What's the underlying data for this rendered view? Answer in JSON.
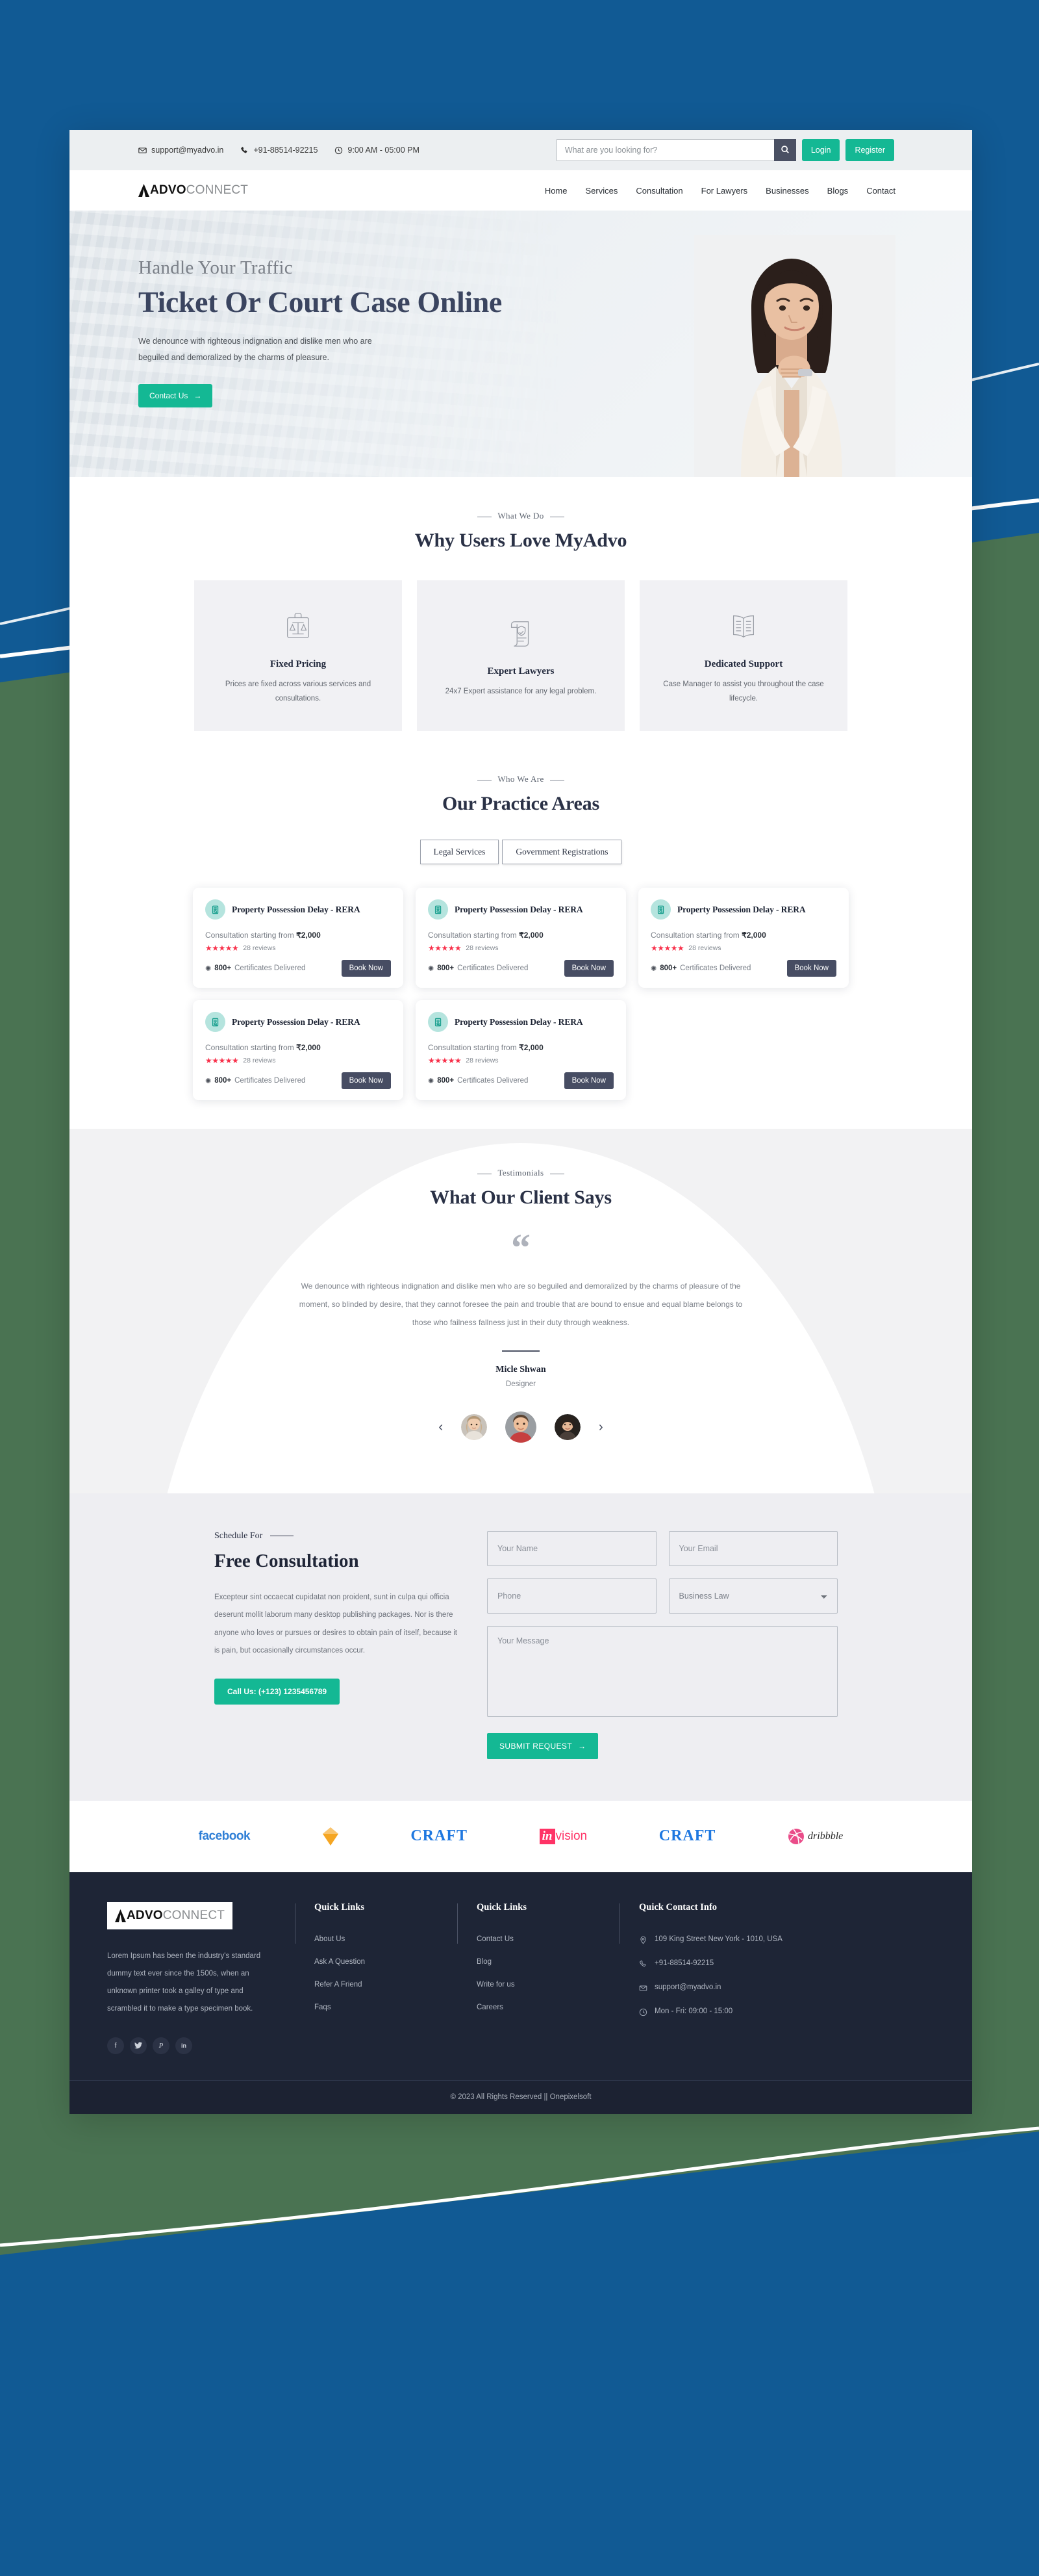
{
  "topbar": {
    "email": "support@myadvo.in",
    "phone": "+91-88514-92215",
    "hours": "9:00 AM - 05:00 PM",
    "search_placeholder": "What are you looking for?",
    "login_label": "Login",
    "register_label": "Register"
  },
  "nav": {
    "logo_bold": "ADVO",
    "logo_light": "CONNECT",
    "links": [
      {
        "label": "Home"
      },
      {
        "label": "Services"
      },
      {
        "label": "Consultation"
      },
      {
        "label": "For Lawyers"
      },
      {
        "label": "Businesses"
      },
      {
        "label": "Blogs"
      },
      {
        "label": "Contact"
      }
    ]
  },
  "hero": {
    "kicker": "Handle Your Traffic",
    "title": "Ticket Or Court Case Online",
    "subtitle": "We denounce with righteous indignation and dislike men who are beguiled and demoralized by the charms of pleasure.",
    "cta_label": "Contact Us"
  },
  "why": {
    "eyebrow": "What We Do",
    "title": "Why Users Love MyAdvo",
    "cards": [
      {
        "icon": "briefcase-scales-icon",
        "name": "Fixed Pricing",
        "desc": "Prices are fixed across various services and consultations."
      },
      {
        "icon": "scroll-shield-icon",
        "name": "Expert Lawyers",
        "desc": "24x7 Expert assistance for any legal problem."
      },
      {
        "icon": "open-book-icon",
        "name": "Dedicated Support",
        "desc": "Case Manager to assist you throughout the case lifecycle."
      }
    ]
  },
  "practice": {
    "eyebrow": "Who We Are",
    "title": "Our Practice Areas",
    "tabs": [
      {
        "label": "Legal Services",
        "active": true
      },
      {
        "label": "Government Registrations",
        "active": false
      }
    ],
    "cards": [
      {
        "title": "Property Possession Delay - RERA",
        "price_label": "Consultation starting from",
        "price": "₹2,000",
        "stars": "★★★★★",
        "reviews": "28 reviews",
        "certs_count": "800+",
        "certs_label": "Certificates Delivered",
        "book_label": "Book Now"
      },
      {
        "title": "Property Possession Delay - RERA",
        "price_label": "Consultation starting from",
        "price": "₹2,000",
        "stars": "★★★★★",
        "reviews": "28 reviews",
        "certs_count": "800+",
        "certs_label": "Certificates Delivered",
        "book_label": "Book Now"
      },
      {
        "title": "Property Possession Delay - RERA",
        "price_label": "Consultation starting from",
        "price": "₹2,000",
        "stars": "★★★★★",
        "reviews": "28 reviews",
        "certs_count": "800+",
        "certs_label": "Certificates Delivered",
        "book_label": "Book Now"
      },
      {
        "title": "Property Possession Delay - RERA",
        "price_label": "Consultation starting from",
        "price": "₹2,000",
        "stars": "★★★★★",
        "reviews": "28 reviews",
        "certs_count": "800+",
        "certs_label": "Certificates Delivered",
        "book_label": "Book Now"
      },
      {
        "title": "Property Possession Delay - RERA",
        "price_label": "Consultation starting from",
        "price": "₹2,000",
        "stars": "★★★★★",
        "reviews": "28 reviews",
        "certs_count": "800+",
        "certs_label": "Certificates Delivered",
        "book_label": "Book Now"
      }
    ]
  },
  "testimonials": {
    "eyebrow": "Testimonials",
    "title": "What Our Client Says",
    "quote_glyph": "“",
    "quote": "We denounce with righteous indignation and dislike men who are so beguiled and demoralized by the charms of pleasure of the moment, so blinded by desire, that they cannot foresee the pain and trouble that are bound to ensue and equal blame belongs to those who failness fallness just in their duty through weakness.",
    "author": "Micle Shwan",
    "role": "Designer",
    "prev_label": "‹",
    "next_label": "›"
  },
  "consultation": {
    "kicker": "Schedule For",
    "title": "Free Consultation",
    "body": "Excepteur sint occaecat cupidatat non proident, sunt in culpa qui officia deserunt mollit laborum many desktop publishing packages. Nor is there anyone who loves or pursues or desires to obtain pain of itself, because it is pain, but occasionally circumstances occur.",
    "call_label": "Call Us: (+123) 1235456789",
    "name_placeholder": "Your Name",
    "email_placeholder": "Your Email",
    "phone_placeholder": "Phone",
    "select_value": "Business Law",
    "message_placeholder": "Your Message",
    "submit_label": "SUBMIT REQUEST"
  },
  "brands": [
    {
      "name": "facebook",
      "label": "facebook"
    },
    {
      "name": "sketch",
      "label": ""
    },
    {
      "name": "craft",
      "label": "CRAFT"
    },
    {
      "name": "invision",
      "label": "invision"
    },
    {
      "name": "craft2",
      "label": "CRAFT"
    },
    {
      "name": "dribbble",
      "label": "dribbble"
    }
  ],
  "footer": {
    "logo_bold": "ADVO",
    "logo_light": "CONNECT",
    "about": "Lorem Ipsum has been the industry's standard dummy text ever since the 1500s, when an unknown printer took a galley of type and scrambled it to make a type specimen book.",
    "social": [
      {
        "icon": "facebook-icon",
        "glyph": "f"
      },
      {
        "icon": "twitter-icon",
        "glyph": "🐦"
      },
      {
        "icon": "pinterest-icon",
        "glyph": "𝑝"
      },
      {
        "icon": "linkedin-icon",
        "glyph": "in"
      }
    ],
    "col2": {
      "heading": "Quick Links",
      "links": [
        {
          "label": "About Us"
        },
        {
          "label": "Ask A Question"
        },
        {
          "label": "Refer A Friend"
        },
        {
          "label": "Faqs"
        }
      ]
    },
    "col3": {
      "heading": "Quick Links",
      "links": [
        {
          "label": "Contact Us"
        },
        {
          "label": "Blog"
        },
        {
          "label": "Write for us"
        },
        {
          "label": "Careers"
        }
      ]
    },
    "col4": {
      "heading": "Quick Contact Info",
      "items": [
        {
          "icon": "location-pin-icon",
          "text": "109 King Street New York - 1010, USA"
        },
        {
          "icon": "phone-icon",
          "text": "+91-88514-92215"
        },
        {
          "icon": "envelope-icon",
          "text": "support@myadvo.in"
        },
        {
          "icon": "clock-icon",
          "text": "Mon - Fri: 09:00 - 15:00"
        }
      ]
    },
    "copyright": "© 2023 All Rights Reserved || Onepixelsoft"
  },
  "colors": {
    "page_backdrop_blue": "#115a94",
    "backdrop_green": "#4a7352",
    "accent_teal": "#14b894",
    "dark_navy": "#1e2536",
    "button_slate": "#474d63",
    "star_red": "#f8304a",
    "icon_chip_mint": "#b5e4de"
  }
}
